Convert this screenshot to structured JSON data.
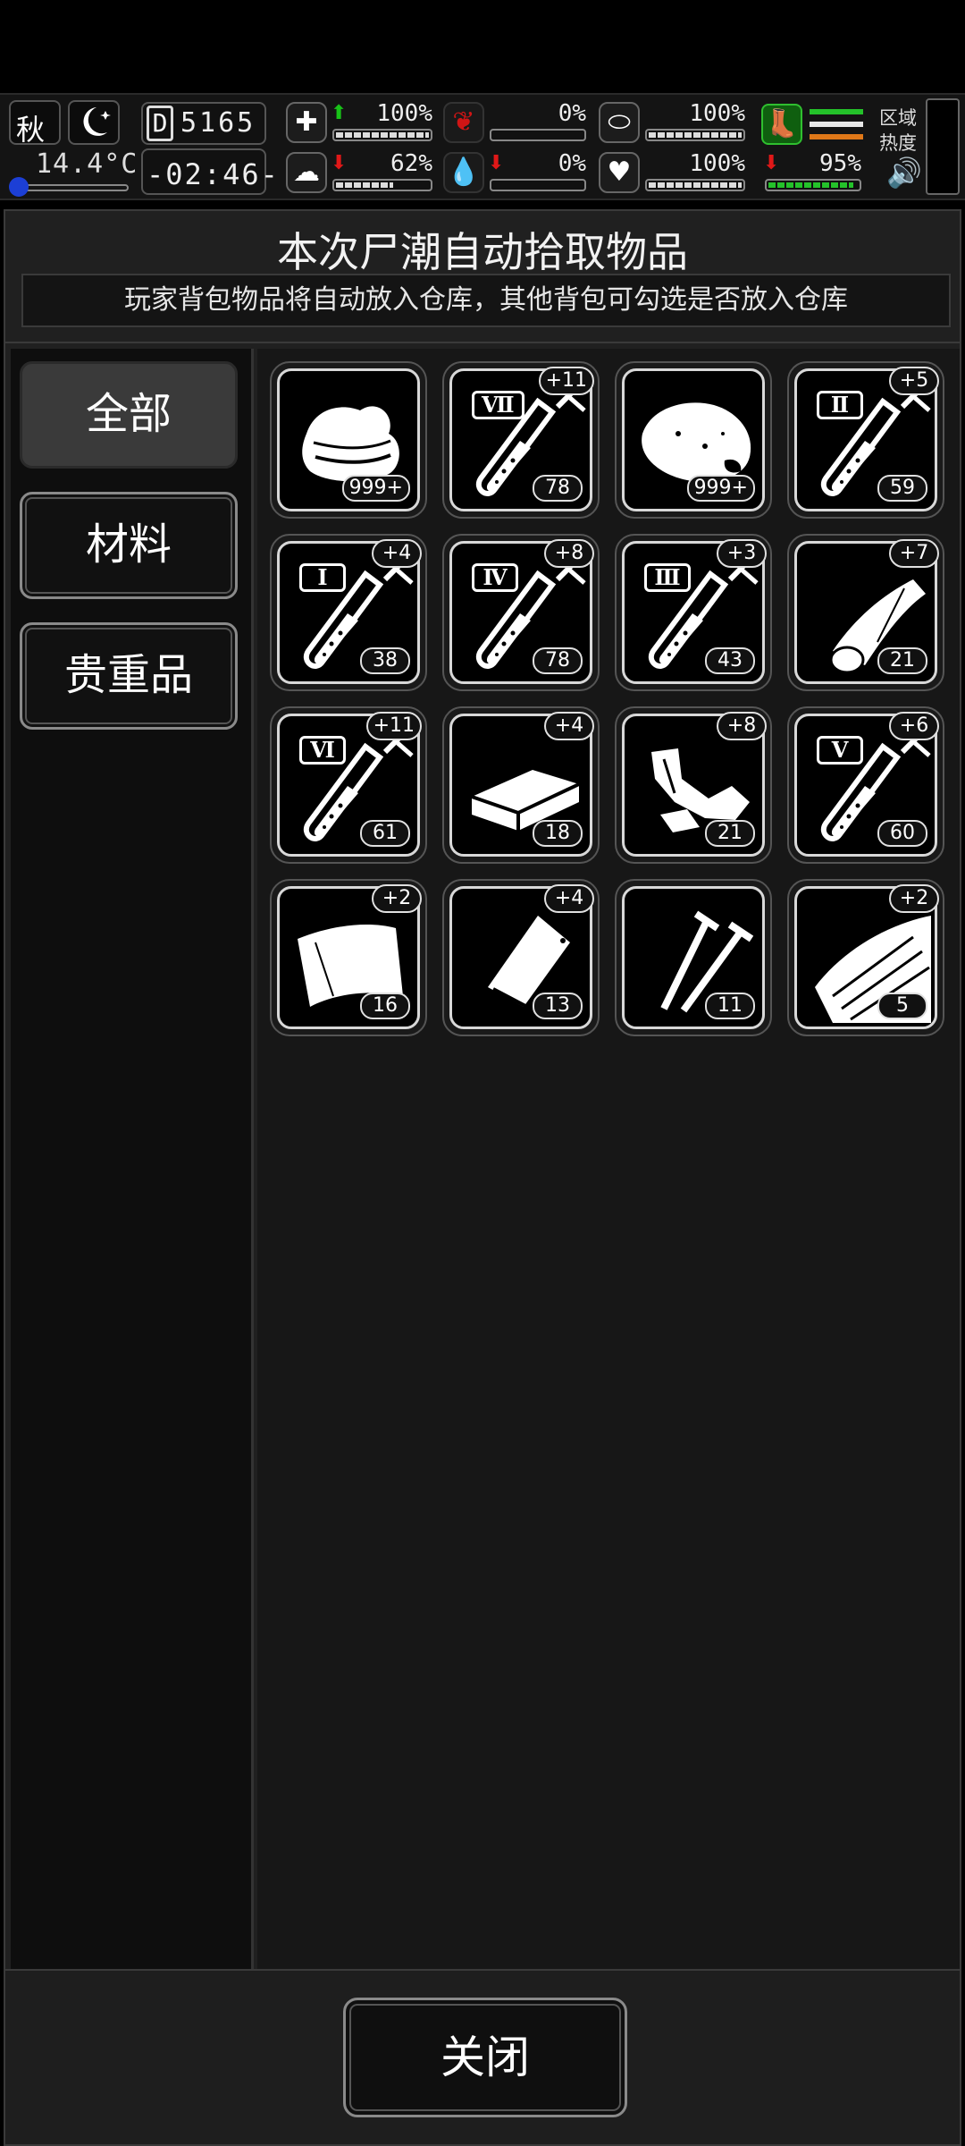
{
  "status": {
    "season": "秋",
    "temperature": "14.4°C",
    "day_letter": "D",
    "day_number": "5165",
    "time": "-02:46-",
    "health": {
      "pct": "100%",
      "level": 1.0
    },
    "stomach": {
      "pct": "0%",
      "level": 0.0
    },
    "pill": {
      "pct": "100%",
      "level": 1.0
    },
    "brain": {
      "pct": "62%",
      "level": 0.62
    },
    "blood": {
      "pct": "0%",
      "level": 0.0
    },
    "heart": {
      "pct": "100%",
      "level": 1.0
    },
    "stamina": {
      "pct": "95%",
      "level": 0.95
    },
    "zone_heat_label": "区域\n热度"
  },
  "dialog": {
    "title": "本次尸潮自动拾取物品",
    "subtitle": "玩家背包物品将自动放入仓库，其他背包可勾选是否放入仓库",
    "close_label": "关闭"
  },
  "tabs": [
    {
      "label": "全部",
      "active": true
    },
    {
      "label": "材料",
      "active": false
    },
    {
      "label": "贵重品",
      "active": false
    }
  ],
  "items": [
    {
      "icon": "cloth-icon",
      "qty": "999+",
      "bonus": "",
      "roman": ""
    },
    {
      "icon": "test-tube-icon",
      "qty": "78",
      "bonus": "+11",
      "roman": "Ⅶ"
    },
    {
      "icon": "meat-icon",
      "qty": "999+",
      "bonus": "",
      "roman": ""
    },
    {
      "icon": "test-tube-icon",
      "qty": "59",
      "bonus": "+5",
      "roman": "Ⅱ"
    },
    {
      "icon": "test-tube-icon",
      "qty": "38",
      "bonus": "+4",
      "roman": "Ⅰ"
    },
    {
      "icon": "test-tube-icon",
      "qty": "78",
      "bonus": "+8",
      "roman": "Ⅳ"
    },
    {
      "icon": "test-tube-icon",
      "qty": "43",
      "bonus": "+3",
      "roman": "Ⅲ"
    },
    {
      "icon": "wood-log-icon",
      "qty": "21",
      "bonus": "+7",
      "roman": ""
    },
    {
      "icon": "test-tube-icon",
      "qty": "61",
      "bonus": "+11",
      "roman": "Ⅵ"
    },
    {
      "icon": "brick-icon",
      "qty": "18",
      "bonus": "+4",
      "roman": ""
    },
    {
      "icon": "scrap-metal-icon",
      "qty": "21",
      "bonus": "+8",
      "roman": ""
    },
    {
      "icon": "test-tube-icon",
      "qty": "60",
      "bonus": "+6",
      "roman": "Ⅴ"
    },
    {
      "icon": "glass-shard-icon",
      "qty": "16",
      "bonus": "+2",
      "roman": ""
    },
    {
      "icon": "plastic-bag-icon",
      "qty": "13",
      "bonus": "+4",
      "roman": ""
    },
    {
      "icon": "nails-icon",
      "qty": "11",
      "bonus": "",
      "roman": ""
    },
    {
      "icon": "wood-planks-icon",
      "qty": "5",
      "bonus": "+2",
      "roman": ""
    }
  ]
}
